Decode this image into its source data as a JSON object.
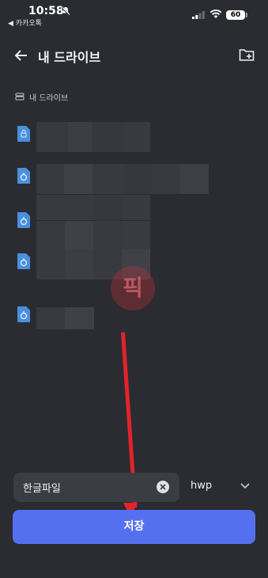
{
  "status_bar": {
    "time": "10:58",
    "back_app": "◀ 카카오톡",
    "battery": "60"
  },
  "header": {
    "title": "내 드라이브"
  },
  "breadcrumb": {
    "label": "내 드라이브"
  },
  "files": [
    {
      "icon": "lock-file-icon",
      "name_obscured": true
    },
    {
      "icon": "shared-file-icon",
      "name_obscured": true
    },
    {
      "icon": "shared-file-icon",
      "name_obscured": true
    },
    {
      "icon": "shared-file-icon",
      "name_obscured": true
    },
    {
      "icon": "shared-file-icon",
      "name_obscured": true
    }
  ],
  "watermark": {
    "text": "픽"
  },
  "save_form": {
    "filename_value": "한글파일",
    "extension_value": "hwp",
    "save_label": "저장"
  },
  "colors": {
    "accent": "#5470f0",
    "annotation_arrow": "#e3232b",
    "background": "#2b2c31"
  }
}
